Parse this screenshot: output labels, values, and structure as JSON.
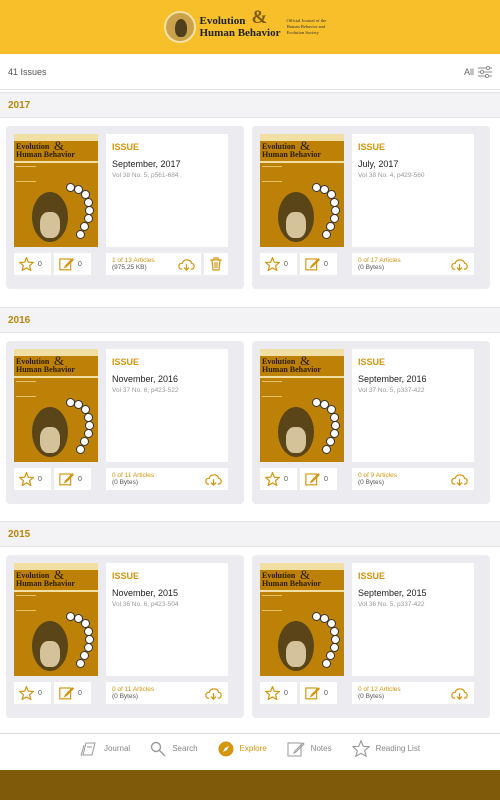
{
  "header": {
    "logo_line1": "Evolution",
    "logo_line2": "Human Behavior",
    "logo_amp": "&",
    "logo_sub": "Official Journal of the Human Behavior and Evolution Society"
  },
  "toolbar": {
    "issue_count": "41 Issues",
    "filter_label": "All"
  },
  "cover": {
    "title_line1": "Evolution",
    "title_line2": "Human Behavior",
    "amp": "&"
  },
  "sections": [
    {
      "year": "2017",
      "issues": [
        {
          "label": "ISSUE",
          "date": "September, 2017",
          "volume": "Vol 38 No. 5, p561-684",
          "stars": "0",
          "notes": "0",
          "articles": "1 of 13 Articles",
          "size": "(975.25 KB)"
        },
        {
          "label": "ISSUE",
          "date": "July, 2017",
          "volume": "Vol 38 No. 4, p429-560",
          "stars": "0",
          "notes": "0",
          "articles": "0 of 17 Articles",
          "size": "(0 Bytes)"
        }
      ]
    },
    {
      "year": "2016",
      "issues": [
        {
          "label": "ISSUE",
          "date": "November, 2016",
          "volume": "Vol 37 No. 6, p423-522",
          "stars": "0",
          "notes": "0",
          "articles": "0 of 11 Articles",
          "size": "(0 Bytes)"
        },
        {
          "label": "ISSUE",
          "date": "September, 2016",
          "volume": "Vol 37 No. 5, p337-422",
          "stars": "0",
          "notes": "0",
          "articles": "0 of 9 Articles",
          "size": "(0 Bytes)"
        }
      ]
    },
    {
      "year": "2015",
      "issues": [
        {
          "label": "ISSUE",
          "date": "November, 2015",
          "volume": "Vol 36 No. 6, p423-504",
          "stars": "0",
          "notes": "0",
          "articles": "0 of 11 Articles",
          "size": "(0 Bytes)"
        },
        {
          "label": "ISSUE",
          "date": "September, 2015",
          "volume": "Vol 36 No. 5, p337-422",
          "stars": "0",
          "notes": "0",
          "articles": "0 of 12 Articles",
          "size": "(0 Bytes)"
        }
      ]
    }
  ],
  "nav": [
    {
      "label": "Journal",
      "icon": "journal-icon"
    },
    {
      "label": "Search",
      "icon": "search-icon"
    },
    {
      "label": "Explore",
      "icon": "compass-icon",
      "active": true
    },
    {
      "label": "Notes",
      "icon": "notes-icon"
    },
    {
      "label": "Reading List",
      "icon": "star-outline-icon"
    }
  ],
  "colors": {
    "header_bg": "#f7bf2a",
    "accent": "#d4960c",
    "footer_band": "#7f5a0a",
    "cover_bg": "#bd8108"
  }
}
